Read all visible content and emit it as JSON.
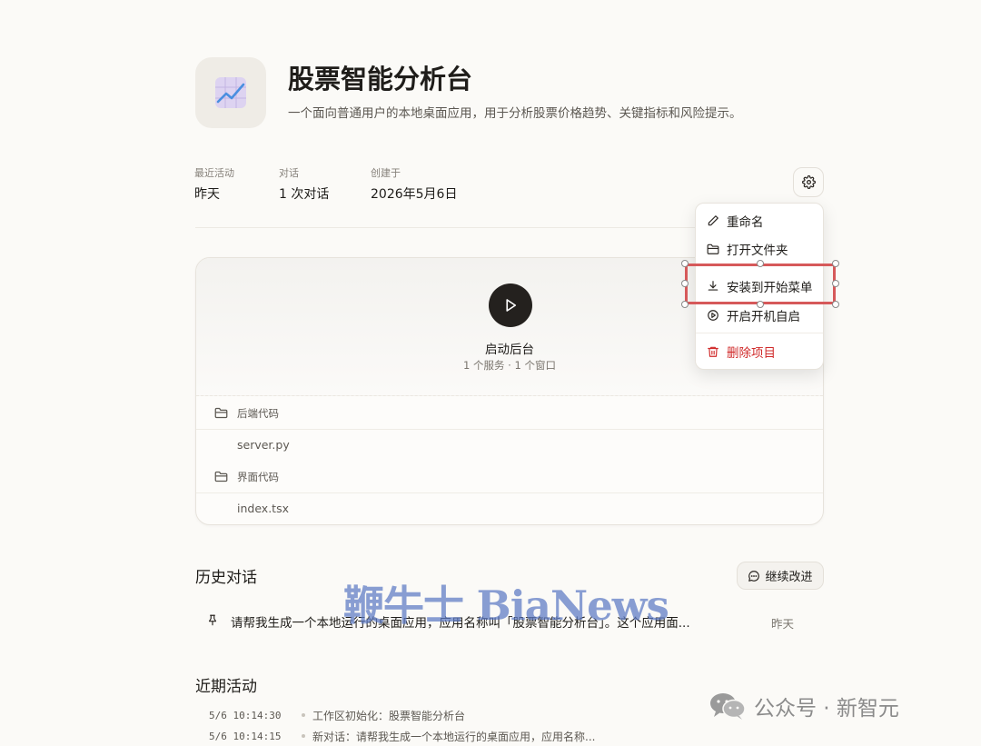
{
  "project": {
    "icon": "chart-trend-icon",
    "title": "股票智能分析台",
    "description": "一个面向普通用户的本地桌面应用，用于分析股票价格趋势、关键指标和风险提示。"
  },
  "meta": [
    {
      "label": "最近活动",
      "value": "昨天"
    },
    {
      "label": "对话",
      "value": "1 次对话"
    },
    {
      "label": "创建于",
      "value": "2026年5月6日"
    }
  ],
  "settings": {
    "icon": "gear-icon"
  },
  "launch": {
    "label": "启动后台",
    "summary": "1 个服务 · 1 个窗口"
  },
  "files": [
    {
      "folder": "后端代码",
      "file": "server.py"
    },
    {
      "folder": "界面代码",
      "file": "index.tsx"
    }
  ],
  "context_menu": {
    "items": [
      {
        "label": "重命名",
        "icon": "pencil-icon"
      },
      {
        "label": "打开文件夹",
        "icon": "folder-icon"
      },
      {
        "label": "安装到开始菜单",
        "icon": "download-icon",
        "highlighted": true
      },
      {
        "label": "开启开机自启",
        "icon": "play-circle-icon"
      },
      {
        "label": "删除项目",
        "icon": "trash-icon",
        "danger": true
      }
    ]
  },
  "history": {
    "title": "历史对话",
    "continue_label": "继续改进",
    "items": [
      {
        "text": "请帮我生成一个本地运行的桌面应用，应用名称叫「股票智能分析台」。这个应用面...",
        "time": "昨天"
      }
    ]
  },
  "activity": {
    "title": "近期活动",
    "items": [
      {
        "time": "5/6 10:14:30",
        "text": "工作区初始化：股票智能分析台"
      },
      {
        "time": "5/6 10:14:15",
        "text": "新对话：请帮我生成一个本地运行的桌面应用，应用名称..."
      }
    ]
  },
  "watermarks": {
    "bianews": "鞭牛士 BiaNews",
    "wechat": "公众号 · 新智元"
  },
  "colors": {
    "background": "#fbfaf7",
    "danger": "#d02a2a",
    "highlight": "#d6595a",
    "watermark": "#5c78c4"
  }
}
